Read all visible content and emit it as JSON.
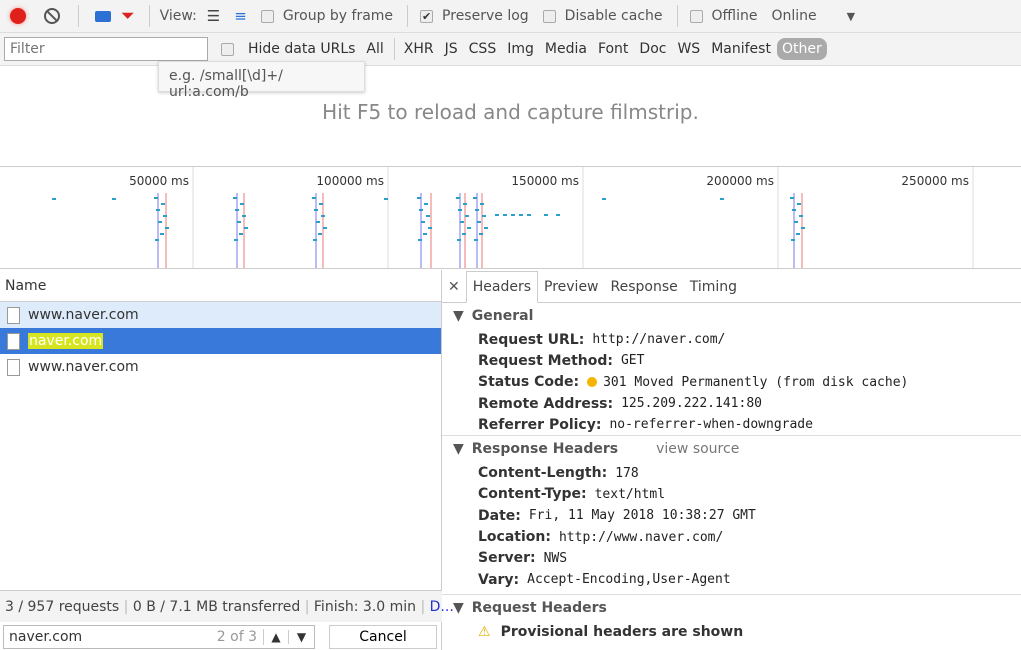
{
  "toolbar": {
    "view_label": "View:",
    "group_by_frame": "Group by frame",
    "preserve_log": "Preserve log",
    "disable_cache": "Disable cache",
    "offline": "Offline",
    "throttling": "Online",
    "record_color": "#e0211b"
  },
  "filterbar": {
    "placeholder": "Filter",
    "hide_data_urls": "Hide data URLs",
    "types": [
      "All",
      "XHR",
      "JS",
      "CSS",
      "Img",
      "Media",
      "Font",
      "Doc",
      "WS",
      "Manifest",
      "Other"
    ],
    "active_type": "Other",
    "tooltip": "e.g. /small[\\d]+/ url:a.com/b"
  },
  "filmstrip": {
    "message": "Hit F5 to reload and capture filmstrip."
  },
  "overview": {
    "ticks": [
      "50000 ms",
      "100000 ms",
      "150000 ms",
      "200000 ms",
      "250000 ms"
    ]
  },
  "requests": {
    "column": "Name",
    "rows": [
      {
        "name": "www.naver.com",
        "state": "highlighted"
      },
      {
        "name": "naver.com",
        "state": "selected"
      },
      {
        "name": "www.naver.com",
        "state": "normal"
      }
    ]
  },
  "status": {
    "requests": "3 / 957 requests",
    "transferred": "0 B / 7.1 MB transferred",
    "finish": "Finish: 3.0 min",
    "more": "D..."
  },
  "search": {
    "value": "naver.com",
    "count": "2 of 3",
    "cancel": "Cancel"
  },
  "details": {
    "tabs": [
      "Headers",
      "Preview",
      "Response",
      "Timing"
    ],
    "active": "Headers",
    "general": {
      "title": "General",
      "items": [
        {
          "k": "Request URL:",
          "v": "http://naver.com/"
        },
        {
          "k": "Request Method:",
          "v": "GET"
        },
        {
          "k": "Status Code:",
          "v": "301 Moved Permanently (from disk cache)"
        },
        {
          "k": "Remote Address:",
          "v": "125.209.222.141:80"
        },
        {
          "k": "Referrer Policy:",
          "v": "no-referrer-when-downgrade"
        }
      ]
    },
    "response": {
      "title": "Response Headers",
      "view_source": "view source",
      "items": [
        {
          "k": "Content-Length:",
          "v": "178"
        },
        {
          "k": "Content-Type:",
          "v": "text/html"
        },
        {
          "k": "Date:",
          "v": "Fri, 11 May 2018 10:38:27 GMT"
        },
        {
          "k": "Location:",
          "v": "http://www.naver.com/"
        },
        {
          "k": "Server:",
          "v": "NWS"
        },
        {
          "k": "Vary:",
          "v": "Accept-Encoding,User-Agent"
        }
      ]
    },
    "request": {
      "title": "Request Headers",
      "warning": "Provisional headers are shown"
    }
  }
}
